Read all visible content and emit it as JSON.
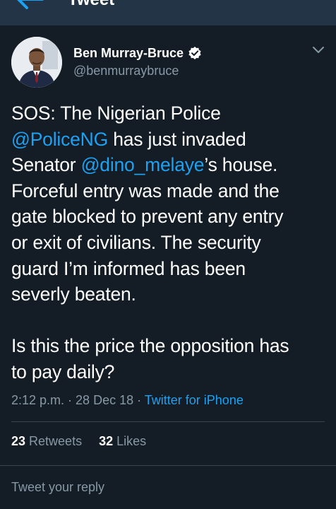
{
  "header": {
    "title": "Tweet",
    "back_icon": "back-arrow-icon"
  },
  "tweet": {
    "author": {
      "name": "Ben Murray-Bruce",
      "handle": "@benmurraybruce",
      "verified": true
    },
    "text": {
      "l1": "SOS: The Nigerian Police",
      "l2_mention": "@PoliceNG",
      "l2_rest": " has just invaded",
      "l3_pre": "Senator ",
      "l3_mention": "@dino_melaye",
      "l3_rest": "’s house.",
      "l4": "Forceful entry was made and the",
      "l5": "gate blocked to prevent any entry",
      "l6": "or exit of civilians. The security",
      "l7": "guard I’m informed has been",
      "l8": "severly beaten.",
      "l9": "Is this the price the opposition has",
      "l10": "to pay daily?"
    },
    "time": "2:12 p.m.",
    "sep1": " · ",
    "date": "28 Dec 18",
    "sep2": " · ",
    "source": "Twitter for iPhone",
    "retweets_count": "23",
    "retweets_label": " Retweets",
    "likes_count": "32",
    "likes_label": " Likes"
  },
  "reply": {
    "placeholder": "Tweet your reply"
  },
  "colors": {
    "background": "#141d26",
    "topbar": "#243447",
    "accent": "#1da1f2",
    "secondary_text": "#8899a6",
    "divider": "#38444d"
  }
}
